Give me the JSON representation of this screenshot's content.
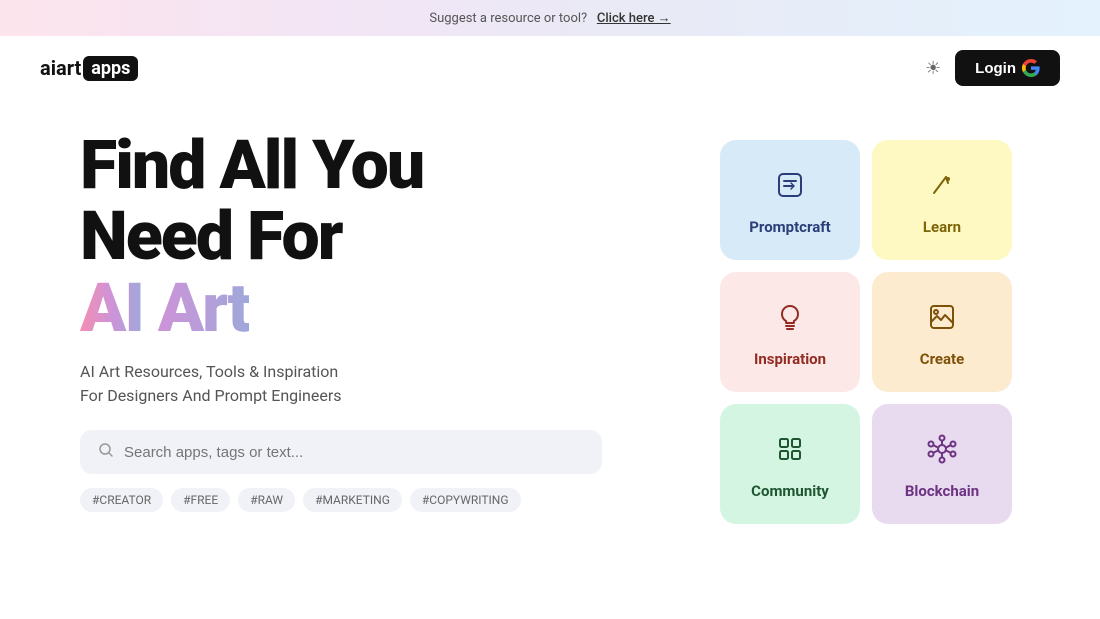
{
  "banner": {
    "text": "Suggest a resource or tool?",
    "link_text": "Click here →",
    "link_href": "#"
  },
  "header": {
    "logo_text": "aiart",
    "logo_apps": "apps",
    "theme_icon": "☀",
    "login_label": "Login"
  },
  "hero": {
    "line1": "Find All You",
    "line2": "Need For",
    "ai_text": "AI",
    "art_text": "Art",
    "subtitle_line1": "AI Art Resources, Tools & Inspiration",
    "subtitle_line2": "For Designers And Prompt Engineers",
    "search_placeholder": "Search apps, tags or text..."
  },
  "tags": [
    {
      "label": "#CREATOR"
    },
    {
      "label": "#FREE"
    },
    {
      "label": "#RAW"
    },
    {
      "label": "#MARKETING"
    },
    {
      "label": "#COPYWRITING"
    }
  ],
  "grid": [
    {
      "id": "promptcraft",
      "label": "Promptcraft",
      "icon_type": "edit"
    },
    {
      "id": "learn",
      "label": "Learn",
      "icon_type": "pencil"
    },
    {
      "id": "inspiration",
      "label": "Inspiration",
      "icon_type": "bulb"
    },
    {
      "id": "create",
      "label": "Create",
      "icon_type": "image"
    },
    {
      "id": "community",
      "label": "Community",
      "icon_type": "grid4"
    },
    {
      "id": "blockchain",
      "label": "Blockchain",
      "icon_type": "atom"
    }
  ]
}
